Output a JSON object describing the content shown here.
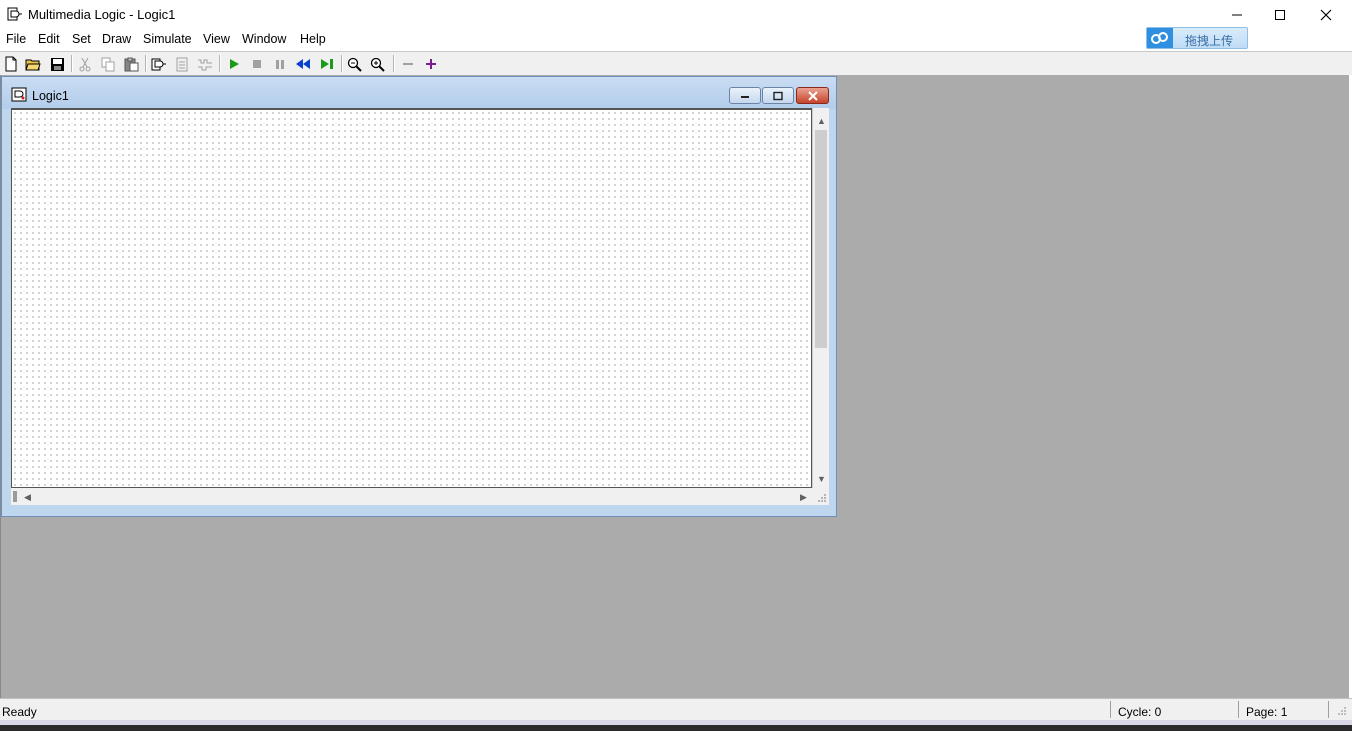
{
  "app": {
    "title": "Multimedia Logic - Logic1",
    "icon": "multimedia-logic-icon",
    "window_controls": [
      "minimize-icon",
      "maximize-icon",
      "close-icon"
    ]
  },
  "menu": [
    "File",
    "Edit",
    "Set",
    "Draw",
    "Simulate",
    "View",
    "Window",
    "Help"
  ],
  "upload_button": {
    "label": "拖拽上传",
    "icon": "cloud-icon",
    "colors": {
      "fill": "#cfe5f8",
      "icon_bg": "#2f8fe0",
      "text": "#3a6ea5"
    }
  },
  "toolbar": [
    {
      "name": "new-file-icon"
    },
    {
      "name": "open-folder-icon"
    },
    {
      "name": "save-icon"
    },
    {
      "name": "cut-icon",
      "disabled": true
    },
    {
      "name": "copy-icon",
      "disabled": true
    },
    {
      "name": "paste-icon"
    },
    {
      "name": "logic-icon"
    },
    {
      "name": "page-icon",
      "disabled": true
    },
    {
      "name": "wave-icon",
      "disabled": true
    },
    {
      "name": "run-icon",
      "color": "#1b9b1b"
    },
    {
      "name": "stop-icon",
      "disabled": true
    },
    {
      "name": "pause-icon",
      "disabled": true
    },
    {
      "name": "rewind-icon",
      "color": "#0b3fd1"
    },
    {
      "name": "step-icon",
      "color": "#1b9b1b"
    },
    {
      "name": "zoom-out-icon"
    },
    {
      "name": "zoom-in-icon"
    },
    {
      "name": "minus-icon",
      "disabled": true
    },
    {
      "name": "plus-icon",
      "color": "#7b1b8f"
    }
  ],
  "document_window": {
    "title": "Logic1",
    "icon": "logic-document-icon",
    "scroll": {
      "vertical_position": 0.05
    }
  },
  "status": {
    "ready": "Ready",
    "cycle": "Cycle: 0",
    "page": "Page: 1"
  },
  "colors": {
    "mdi_background": "#ababab",
    "child_frame": "#bfd6ef",
    "close_button": "#c7442b"
  }
}
